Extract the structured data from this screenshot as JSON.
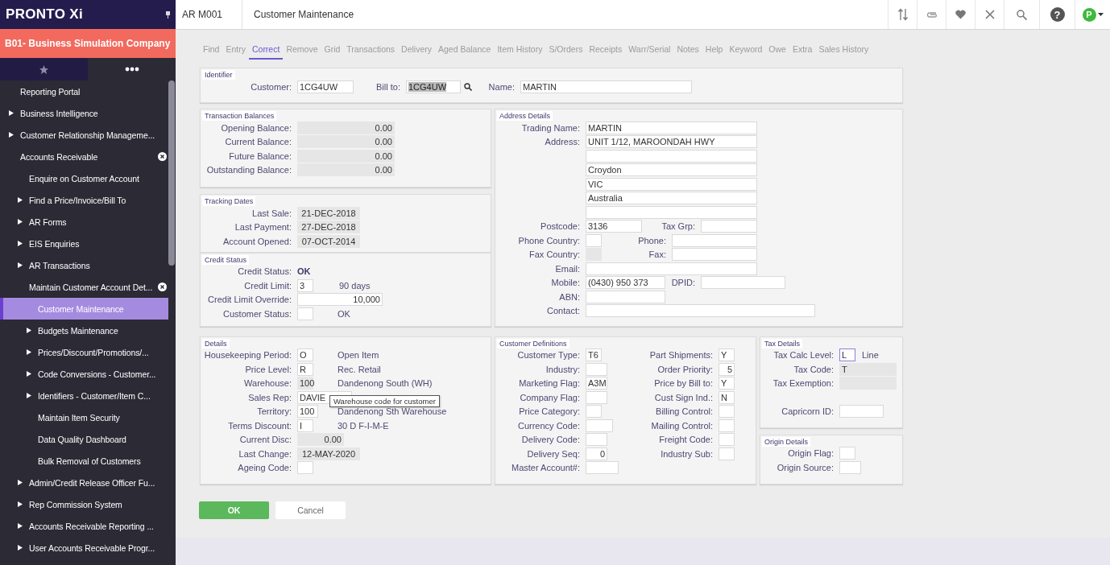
{
  "sidebar": {
    "logo": "PRONTO Xi",
    "company": "B01- Business Simulation Company",
    "tabs": [
      {
        "selected": false
      },
      {
        "selected": true
      }
    ],
    "menu": [
      {
        "label": "Reporting Portal",
        "kind": "leaf",
        "selected": false
      },
      {
        "label": "Business Intelligence",
        "kind": "folder",
        "expanded": false,
        "selected": false
      },
      {
        "label": "Customer Relationship Manageme...",
        "kind": "folder",
        "expanded": false,
        "selected": false
      },
      {
        "label": "Accounts Receivable",
        "kind": "folder",
        "expanded": true,
        "selected": false,
        "children": [
          {
            "label": "Enquire on Customer Account",
            "kind": "leaf",
            "selected": false
          },
          {
            "label": "Find a Price/Invoice/Bill To",
            "kind": "folder",
            "expanded": false,
            "selected": false
          },
          {
            "label": "AR Forms",
            "kind": "folder",
            "expanded": false,
            "selected": false
          },
          {
            "label": "EIS Enquiries",
            "kind": "folder",
            "expanded": false,
            "selected": false
          },
          {
            "label": "AR Transactions",
            "kind": "folder",
            "expanded": false,
            "selected": false
          },
          {
            "label": "Maintain Customer Account Det...",
            "kind": "folder",
            "expanded": true,
            "selected": false,
            "children": [
              {
                "label": "Customer Maintenance",
                "kind": "leaf",
                "selected": true
              },
              {
                "label": "Budgets Maintenance",
                "kind": "folder",
                "expanded": false,
                "selected": false
              },
              {
                "label": "Prices/Discount/Promotions/...",
                "kind": "folder",
                "expanded": false,
                "selected": false
              },
              {
                "label": "Code Conversions - Customer...",
                "kind": "folder",
                "expanded": false,
                "selected": false
              },
              {
                "label": "Identifiers - Customer/Item C...",
                "kind": "folder",
                "expanded": false,
                "selected": false
              },
              {
                "label": "Maintain Item Security",
                "kind": "leaf",
                "selected": false
              },
              {
                "label": "Data Quality Dashboard",
                "kind": "leaf",
                "selected": false
              },
              {
                "label": "Bulk Removal of Customers",
                "kind": "leaf",
                "selected": false
              }
            ]
          },
          {
            "label": "Admin/Credit Release Officer Fu...",
            "kind": "folder",
            "expanded": false,
            "selected": false
          },
          {
            "label": "Rep Commission System",
            "kind": "folder",
            "expanded": false,
            "selected": false
          },
          {
            "label": "Accounts Receivable Reporting ...",
            "kind": "folder",
            "expanded": false,
            "selected": false
          },
          {
            "label": "User Accounts Receivable Progr...",
            "kind": "folder",
            "expanded": false,
            "selected": false
          }
        ]
      }
    ]
  },
  "header": {
    "code": "AR M001",
    "title": "Customer Maintenance",
    "help": "?",
    "avatar": "P"
  },
  "tabs": [
    {
      "label": "Find",
      "selected": false
    },
    {
      "label": "Entry",
      "selected": false
    },
    {
      "label": "Correct",
      "selected": true
    },
    {
      "label": "Remove",
      "selected": false
    },
    {
      "label": "Grid",
      "selected": false
    },
    {
      "label": "Transactions",
      "selected": false
    },
    {
      "label": "Delivery",
      "selected": false
    },
    {
      "label": "Aged Balance",
      "selected": false
    },
    {
      "label": "Item History",
      "selected": false
    },
    {
      "label": "S/Orders",
      "selected": false
    },
    {
      "label": "Receipts",
      "selected": false
    },
    {
      "label": "Warr/Serial",
      "selected": false
    },
    {
      "label": "Notes",
      "selected": false
    },
    {
      "label": "Help",
      "selected": false
    },
    {
      "label": "Keyword",
      "selected": false
    },
    {
      "label": "Owe",
      "selected": false
    },
    {
      "label": "Extra",
      "selected": false
    },
    {
      "label": "Sales History",
      "selected": false
    }
  ],
  "form": {
    "identifier": {
      "title": "Identifier",
      "rows": [
        [
          {
            "label": "Customer:",
            "kind": "input",
            "value": "1CG4UW"
          },
          {
            "label": "Bill to:",
            "kind": "lookup",
            "value": "1CG4UW"
          },
          {
            "label": "Name:",
            "kind": "input",
            "value": "MARTIN"
          }
        ]
      ]
    },
    "left_column": [
      {
        "title": "Transaction Balances",
        "rows": [
          [
            {
              "label": "Opening Balance:",
              "kind": "amount",
              "value": "0.00"
            }
          ],
          [
            {
              "label": "Current Balance:",
              "kind": "amount",
              "value": "0.00"
            }
          ],
          [
            {
              "label": "Future Balance:",
              "kind": "amount",
              "value": "0.00"
            }
          ],
          [
            {
              "label": "Outstanding Balance:",
              "kind": "amount",
              "value": "0.00"
            }
          ]
        ]
      },
      {
        "title": "Tracking Dates",
        "rows": [
          [
            {
              "label": "Last Sale:",
              "kind": "date",
              "value": "21-DEC-2018"
            }
          ],
          [
            {
              "label": "Last Payment:",
              "kind": "date",
              "value": "27-DEC-2018"
            }
          ],
          [
            {
              "label": "Account Opened:",
              "kind": "date",
              "value": "07-OCT-2014"
            }
          ]
        ]
      },
      {
        "title": "Credit Status",
        "rows": [
          [
            {
              "label": "Credit Status:",
              "kind": "text",
              "value": "OK"
            }
          ],
          [
            {
              "label": "Credit Limit:",
              "kind": "input",
              "value": "3",
              "note": "90 days"
            }
          ],
          [
            {
              "label": "Credit Limit Override:",
              "kind": "number",
              "value": "10,000"
            }
          ],
          [
            {
              "label": "Customer Status:",
              "kind": "input",
              "note": "OK"
            }
          ]
        ]
      }
    ],
    "address": {
      "title": "Address Details",
      "rows": [
        [
          {
            "label": "Trading Name:",
            "kind": "input",
            "value": "MARTIN"
          }
        ],
        [
          {
            "label": "Address:",
            "kind": "input",
            "value": "UNIT 1/12, MAROONDAH HWY"
          }
        ],
        [
          {
            "kind": "input"
          }
        ],
        [
          {
            "kind": "input",
            "value": "Croydon"
          }
        ],
        [
          {
            "kind": "input",
            "value": "VIC"
          }
        ],
        [
          {
            "kind": "input",
            "value": "Australia"
          }
        ],
        [
          {
            "kind": "input"
          }
        ],
        [
          {
            "label": "Postcode:",
            "kind": "input",
            "value": "3136"
          },
          {
            "label": "Tax Grp:",
            "kind": "input"
          }
        ],
        [
          {
            "label": "Phone Country:",
            "kind": "input"
          },
          {
            "label": "Phone:",
            "kind": "input"
          }
        ],
        [
          {
            "label": "Fax Country:",
            "kind": "readonly"
          },
          {
            "label": "Fax:",
            "kind": "input"
          }
        ],
        [
          {
            "label": "Email:",
            "kind": "input"
          }
        ],
        [
          {
            "label": "Mobile:",
            "kind": "input",
            "value": "(0430) 950 373"
          },
          {
            "label": "DPID:",
            "kind": "input"
          }
        ],
        [
          {
            "label": "ABN:",
            "kind": "input"
          }
        ],
        [
          {
            "label": "Contact:",
            "kind": "input"
          }
        ]
      ]
    },
    "details": {
      "title": "Details",
      "rows": [
        [
          {
            "label": "Housekeeping Period:",
            "kind": "input",
            "value": "O",
            "note": "Open Item"
          }
        ],
        [
          {
            "label": "Price Level:",
            "kind": "input",
            "value": "R",
            "note": "Rec. Retail"
          }
        ],
        [
          {
            "label": "Warehouse:",
            "kind": "readonly",
            "value": "100",
            "note": "Dandenong South (WH)"
          }
        ],
        [
          {
            "label": "Sales Rep:",
            "kind": "input",
            "value": "DAVIE",
            "tooltip": "Warehouse code for customer"
          }
        ],
        [
          {
            "label": "Territory:",
            "kind": "input",
            "value": "100",
            "note": "Dandenong Sth Warehouse"
          }
        ],
        [
          {
            "label": "Terms Discount:",
            "kind": "input",
            "value": "I",
            "note": "30 D F-I-M-E"
          }
        ],
        [
          {
            "label": "Current Disc:",
            "kind": "amount",
            "value": "0.00"
          }
        ],
        [
          {
            "label": "Last Change:",
            "kind": "date",
            "value": "12-MAY-2020"
          }
        ],
        [
          {
            "label": "Ageing Code:",
            "kind": "input"
          }
        ]
      ]
    },
    "definitions": {
      "title": "Customer Definitions",
      "rows": [
        [
          {
            "label": "Customer Type:",
            "kind": "input",
            "value": "T6"
          },
          {
            "label": "Part Shipments:",
            "kind": "input",
            "value": "Y"
          }
        ],
        [
          {
            "label": "Industry:",
            "kind": "input"
          },
          {
            "label": "Order Priority:",
            "kind": "number",
            "value": "5"
          }
        ],
        [
          {
            "label": "Marketing Flag:",
            "kind": "input",
            "value": "A3M"
          },
          {
            "label": "Price by Bill to:",
            "kind": "input",
            "value": "Y"
          }
        ],
        [
          {
            "label": "Company Flag:",
            "kind": "input"
          },
          {
            "label": "Cust Sign Ind.:",
            "kind": "input",
            "value": "N"
          }
        ],
        [
          {
            "label": "Price Category:",
            "kind": "input"
          },
          {
            "label": "Billing Control:",
            "kind": "input"
          }
        ],
        [
          {
            "label": "Currency Code:",
            "kind": "input"
          },
          {
            "label": "Mailing Control:",
            "kind": "input"
          }
        ],
        [
          {
            "label": "Delivery Code:",
            "kind": "input"
          },
          {
            "label": "Freight Code:",
            "kind": "input"
          }
        ],
        [
          {
            "label": "Delivery Seq:",
            "kind": "number",
            "value": "0"
          },
          {
            "label": "Industry Sub:",
            "kind": "input"
          }
        ],
        [
          {
            "label": "Master Account#:",
            "kind": "input"
          }
        ]
      ]
    },
    "right_column": [
      {
        "title": "Tax Details",
        "rows": [
          [
            {
              "label": "Tax Calc Level:",
              "kind": "active",
              "value": "L",
              "note": "Line"
            }
          ],
          [
            {
              "label": "Tax Code:",
              "kind": "readonly",
              "value": "T"
            }
          ],
          [
            {
              "label": "Tax Exemption:",
              "kind": "readonly"
            }
          ],
          [
            {
              "label": "Capricorn ID:",
              "kind": "input"
            }
          ]
        ]
      },
      {
        "title": "Origin Details",
        "rows": [
          [
            {
              "label": "Origin Flag:",
              "kind": "input"
            }
          ],
          [
            {
              "label": "Origin Source:",
              "kind": "input"
            }
          ]
        ]
      }
    ]
  },
  "buttons": [
    {
      "label": "OK",
      "kind": "primary"
    },
    {
      "label": "Cancel",
      "kind": "secondary"
    }
  ]
}
